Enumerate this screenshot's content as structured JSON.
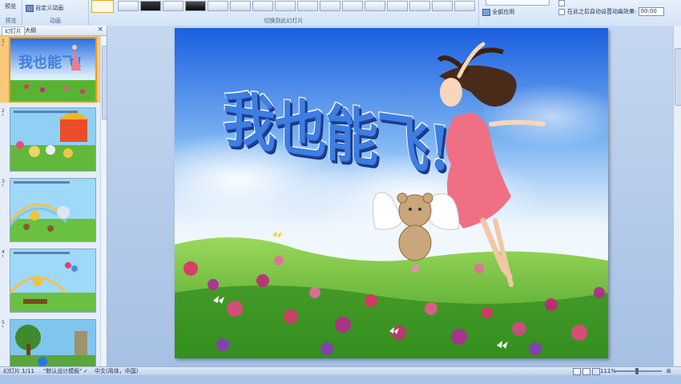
{
  "ribbon": {
    "preview_label": "预览",
    "custom_animation_label": "自定义动画",
    "group_preview": "预览",
    "group_animation": "动画",
    "group_transition": "切换到此幻灯片",
    "apply_all_label": "全部应用",
    "advance_after_label": "在此之后自动设置动画效果:",
    "advance_time_value": "00:00"
  },
  "pane": {
    "tab_slides": "幻灯片",
    "tab_outline": "大纲",
    "close": "×"
  },
  "slides": [
    {
      "number": "1",
      "star": "*"
    },
    {
      "number": "2",
      "star": "*"
    },
    {
      "number": "3",
      "star": "*"
    },
    {
      "number": "4",
      "star": "*"
    },
    {
      "number": "5",
      "star": "*"
    }
  ],
  "slide": {
    "title": "我也能飞!"
  },
  "status": {
    "slide_counter": "幻灯片 1/11",
    "theme": "\"默认设计模板\"",
    "language": "中文(简体，中国)",
    "zoom": "111%"
  },
  "colors": {
    "ribbon_bg": "#d3e3f7",
    "selected_slide": "#f8c97a",
    "title_text": "#3e7ee0"
  }
}
